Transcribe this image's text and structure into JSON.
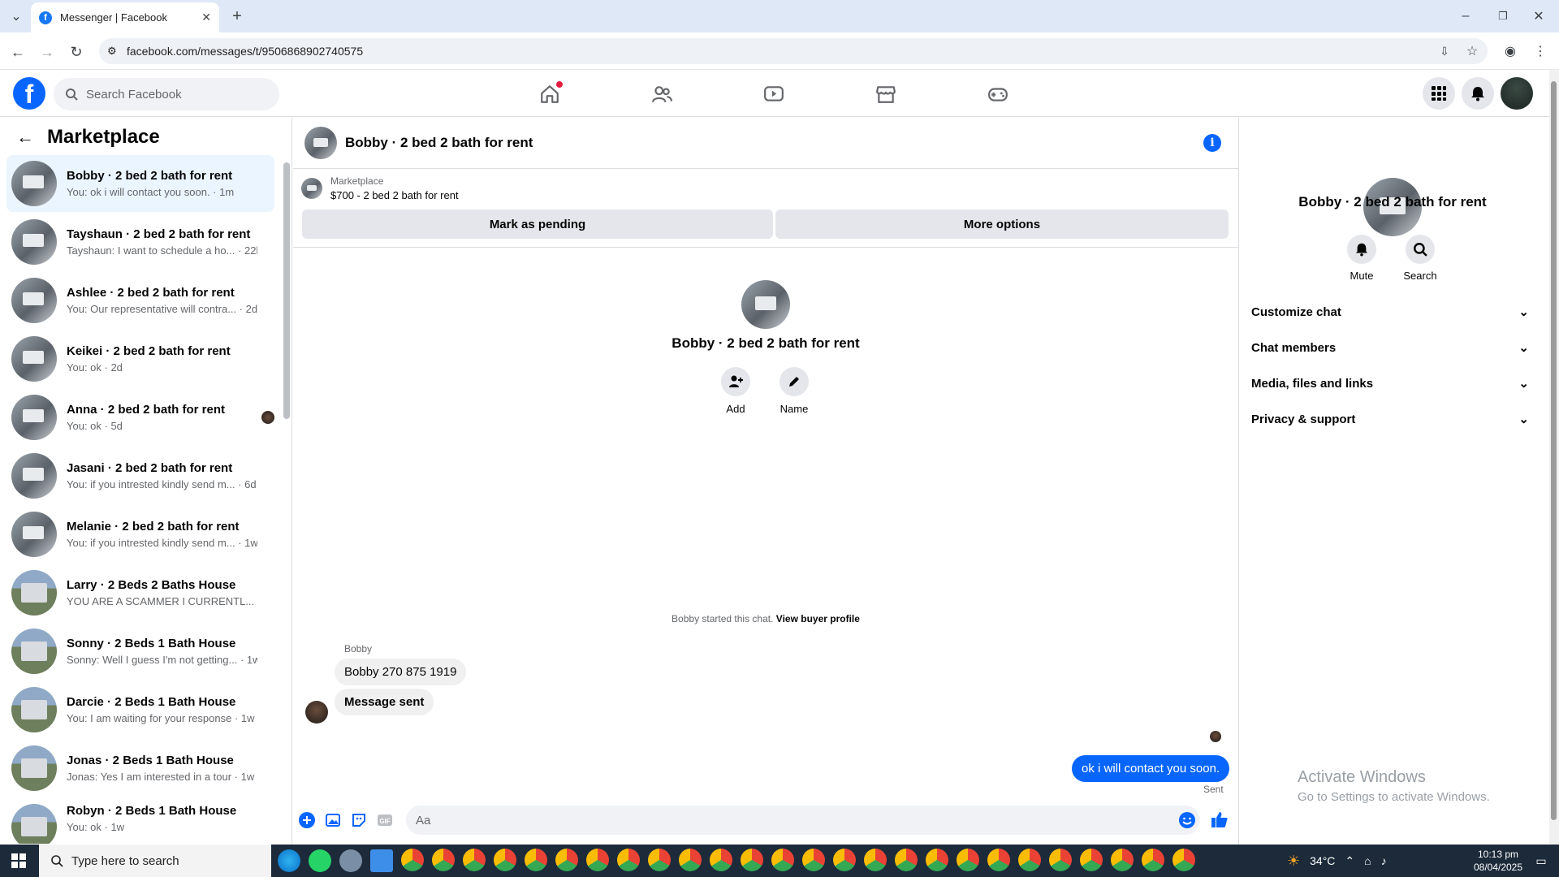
{
  "browser": {
    "tab_title": "Messenger | Facebook",
    "url": "facebook.com/messages/t/9506868902740575"
  },
  "fb": {
    "search_placeholder": "Search Facebook"
  },
  "sidebar": {
    "title": "Marketplace",
    "conversations": [
      {
        "name": "Bobby · 2 bed 2 bath for rent",
        "preview": "You: ok i will contact you soon. · 1m"
      },
      {
        "name": "Tayshaun · 2 bed 2 bath for rent",
        "preview": "Tayshaun: I want to schedule a ho... · 22h"
      },
      {
        "name": "Ashlee · 2 bed 2 bath for rent",
        "preview": "You: Our representative will contra... · 2d"
      },
      {
        "name": "Keikei · 2 bed 2 bath for rent",
        "preview": "You: ok · 2d"
      },
      {
        "name": "Anna · 2 bed 2 bath for rent",
        "preview": "You: ok · 5d"
      },
      {
        "name": "Jasani · 2 bed 2 bath for rent",
        "preview": "You: if you intrested kindly send m... · 6d"
      },
      {
        "name": "Melanie · 2 bed 2 bath for rent",
        "preview": "You: if you intrested kindly send m... · 1w"
      },
      {
        "name": "Larry · 2 Beds 2 Baths House",
        "preview": "YOU ARE A SCAMMER I CURRENTL... · 1w"
      },
      {
        "name": "Sonny · 2 Beds 1 Bath House",
        "preview": "Sonny: Well I guess I'm not getting... · 1w"
      },
      {
        "name": "Darcie · 2 Beds 1 Bath House",
        "preview": "You: I am waiting for your response · 1w"
      },
      {
        "name": "Jonas · 2 Beds 1 Bath House",
        "preview": "Jonas: Yes I am interested in a tour · 1w"
      },
      {
        "name": "Robyn · 2 Beds 1 Bath House",
        "preview": "You: ok · 1w"
      }
    ]
  },
  "chat": {
    "title": "Bobby · 2 bed 2 bath for rent",
    "marketplace_label": "Marketplace",
    "listing": "$700 - 2 bed 2 bath for rent",
    "mark_pending": "Mark as pending",
    "more_options": "More options",
    "center_name": "Bobby · 2 bed 2 bath for rent",
    "add_label": "Add",
    "name_label": "Name",
    "started_text": "Bobby started this chat.",
    "view_profile": "View buyer profile",
    "sender": "Bobby",
    "messages_in": [
      "Bobby 270 875 1919",
      "Message sent"
    ],
    "message_out": "ok i will contact you soon.",
    "sent_status": "Sent",
    "input_placeholder": "Aa"
  },
  "right_panel": {
    "name": "Bobby · 2 bed 2 bath for rent",
    "mute_label": "Mute",
    "search_label": "Search",
    "sections": [
      "Customize chat",
      "Chat members",
      "Media, files and links",
      "Privacy & support"
    ]
  },
  "watermark": {
    "line1": "Activate Windows",
    "line2": "Go to Settings to activate Windows."
  },
  "taskbar": {
    "search_placeholder": "Type here to search",
    "temperature": "34°C",
    "time": "10:13 pm",
    "date": "08/04/2025"
  },
  "colors": {
    "brand": "#0866ff",
    "active_conv": "#ebf5ff",
    "taskbar": "#1c2a3a"
  }
}
